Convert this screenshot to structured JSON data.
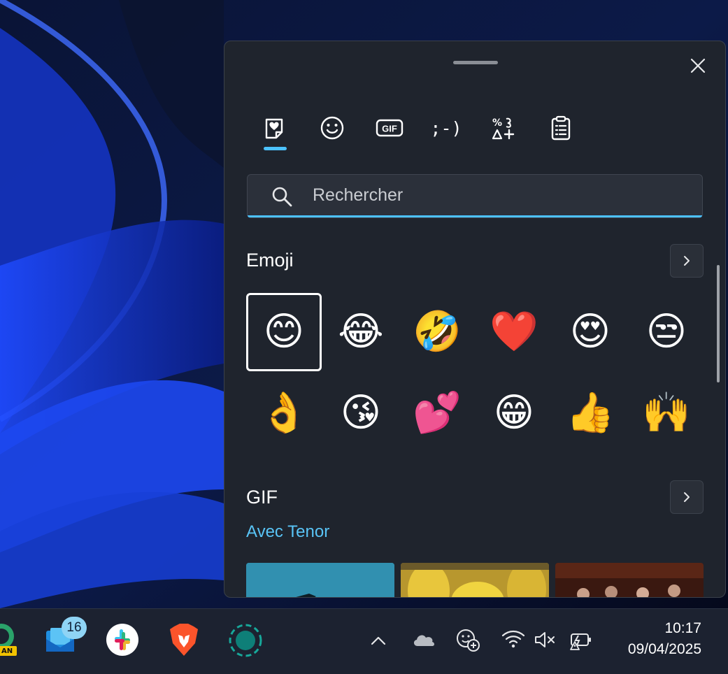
{
  "panel": {
    "search": {
      "placeholder": "Rechercher"
    },
    "tabs": [
      {
        "name": "favorites",
        "icon": "heart-note-icon"
      },
      {
        "name": "emoji",
        "icon": "smiley-icon"
      },
      {
        "name": "gif",
        "icon": "gif-icon",
        "label": "GIF"
      },
      {
        "name": "kaomoji",
        "icon": "kaomoji-icon",
        "label": ";-)"
      },
      {
        "name": "symbols",
        "icon": "symbols-icon"
      },
      {
        "name": "clipboard",
        "icon": "clipboard-icon"
      }
    ],
    "emoji_section": {
      "title": "Emoji",
      "items": [
        "😊",
        "😂",
        "🤣",
        "❤️",
        "😍",
        "😒",
        "👌",
        "😘",
        "💕",
        "😁",
        "👍",
        "🙌"
      ]
    },
    "gif_section": {
      "title": "GIF",
      "subtitle": "Avec Tenor"
    }
  },
  "taskbar": {
    "badge_count": "16",
    "app_label": "AN",
    "time": "10:17",
    "date": "09/04/2025"
  },
  "colors": {
    "accent": "#4cc2ff",
    "panel_bg": "#1f242d",
    "taskbar_bg": "#1c2230"
  }
}
